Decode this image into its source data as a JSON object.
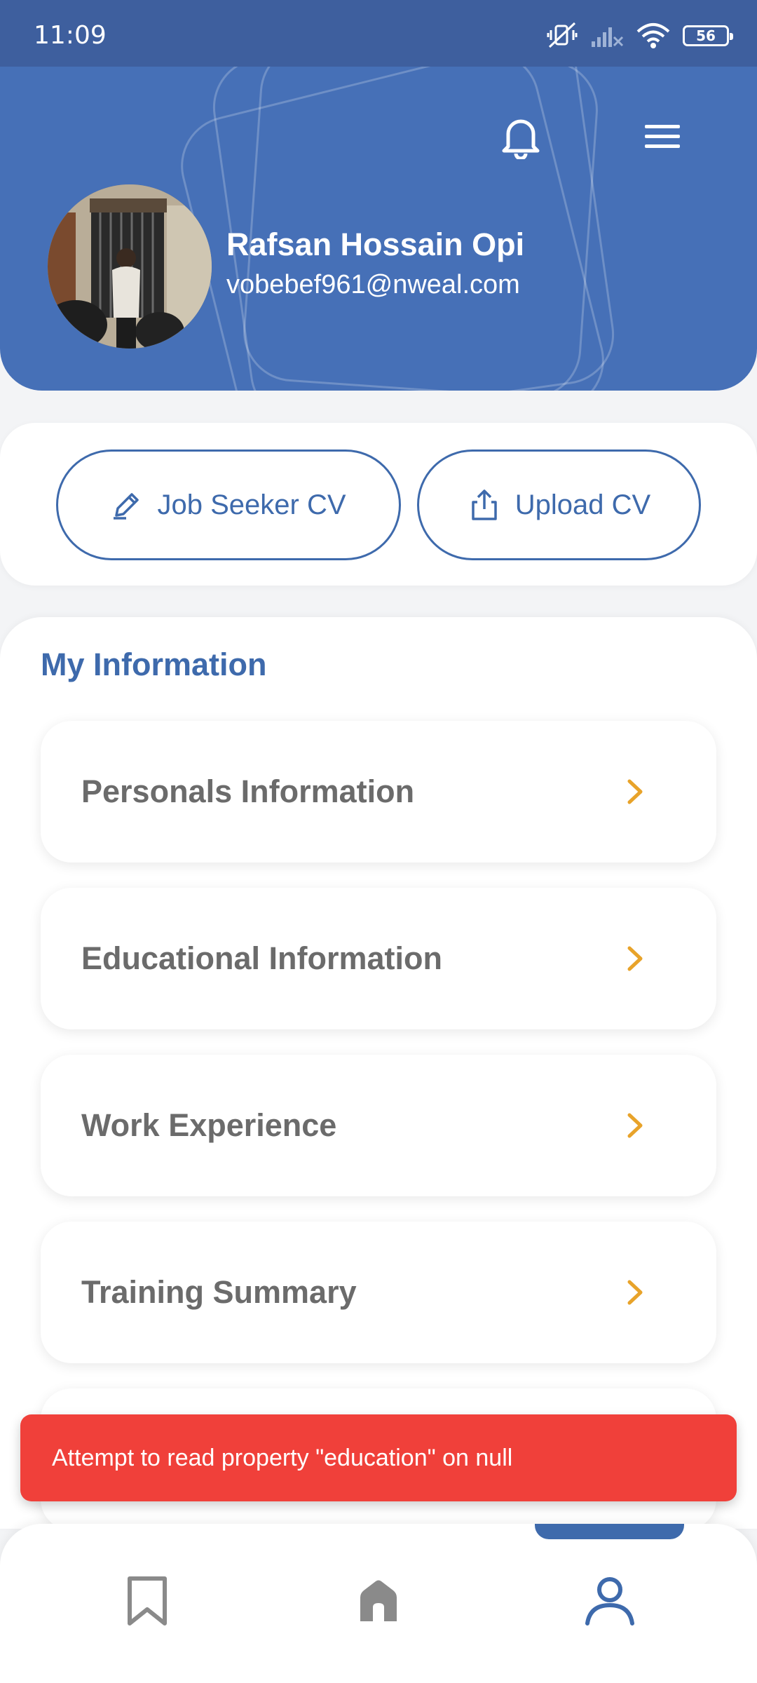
{
  "status_bar": {
    "time": "11:09",
    "battery": "56"
  },
  "header": {
    "user_name": "Rafsan Hossain Opi",
    "user_email": "vobebef961@nweal.com"
  },
  "cv_actions": {
    "seeker_label": "Job Seeker CV",
    "upload_label": "Upload CV"
  },
  "my_information": {
    "title": "My Information",
    "items": [
      {
        "label": "Personals Information"
      },
      {
        "label": "Educational Information"
      },
      {
        "label": "Work Experience"
      },
      {
        "label": "Training Summary"
      }
    ]
  },
  "snackbar": {
    "message": "Attempt to read property \"education\" on null"
  },
  "bottom_nav": {
    "items": [
      "bookmark-icon",
      "home-icon",
      "profile-icon"
    ],
    "active": "profile"
  },
  "colors": {
    "primary": "#4670b7",
    "accent": "#3e6aac",
    "chevron": "#e8a32a",
    "error": "#f0403a"
  }
}
